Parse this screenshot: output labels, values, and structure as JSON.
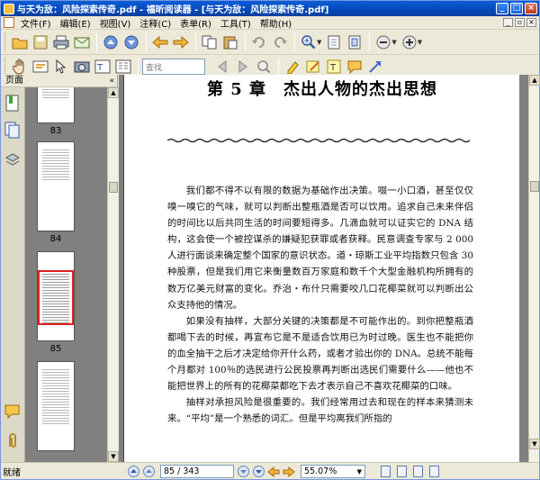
{
  "window": {
    "title": "与天为敌：风险探索传奇.pdf - 福昕阅读器 - [与天为敌：风险探索传奇.pdf]",
    "minimize": "_",
    "maximize": "□",
    "close": "×"
  },
  "menu": {
    "items": [
      "文件(F)",
      "编辑(E)",
      "视图(V)",
      "注释(C)",
      "表单(R)",
      "工具(T)",
      "帮助(H)"
    ]
  },
  "toolbar2": {
    "search_placeholder": "查找"
  },
  "left_pane": {
    "title": "页面",
    "collapse": "«",
    "thumbnails": [
      {
        "label": "83"
      },
      {
        "label": "84"
      },
      {
        "label": "85"
      }
    ]
  },
  "document": {
    "chapter_title": "第 5 章　杰出人物的杰出思想",
    "paragraphs": [
      "我们都不得不以有限的数据为基础作出决策。啜一小口酒，甚至仅仅嗅一嗅它的气味，就可以判断出整瓶酒是否可以饮用。追求自己未来伴侣的时间比以后共同生活的时间要短得多。几滴血就可以证实它的 DNA 结构，这会使一个被控谋杀的嫌疑犯获罪或者获释。民意调查专家与 2 000 人进行面谈来确定整个国家的意识状态。道・琼斯工业平均指数只包含 30 种股票，但是我们用它来衡量数百万家庭和数千个大型金融机构所拥有的数万亿美元财富的变化。乔治・布什只需要咬几口花椰菜就可以判断出公众支持他的情况。",
      "如果没有抽样，大部分关键的决策都是不可能作出的。到你把整瓶酒都喝下去的时候，再宣布它是不是适合饮用已为时过晚。医生也不能把你的血全抽干之后才决定给你开什么药，或者才验出你的 DNA。总统不能每个月都对 100％的选民进行公民投票再判断出选民们需要什么——他也不能把世界上的所有的花椰菜都吃下去才表示自己不喜欢花椰菜的口味。",
      "抽样对承担风险是很重要的。我们经常用过去和现在的样本来猜测未来。“平均”是一个熟悉的词汇。但是平均离我们所指的"
    ]
  },
  "status": {
    "text": "就绪",
    "page_display": "85 / 343",
    "zoom": "55.07%",
    "zoom_arrow": "▼"
  }
}
